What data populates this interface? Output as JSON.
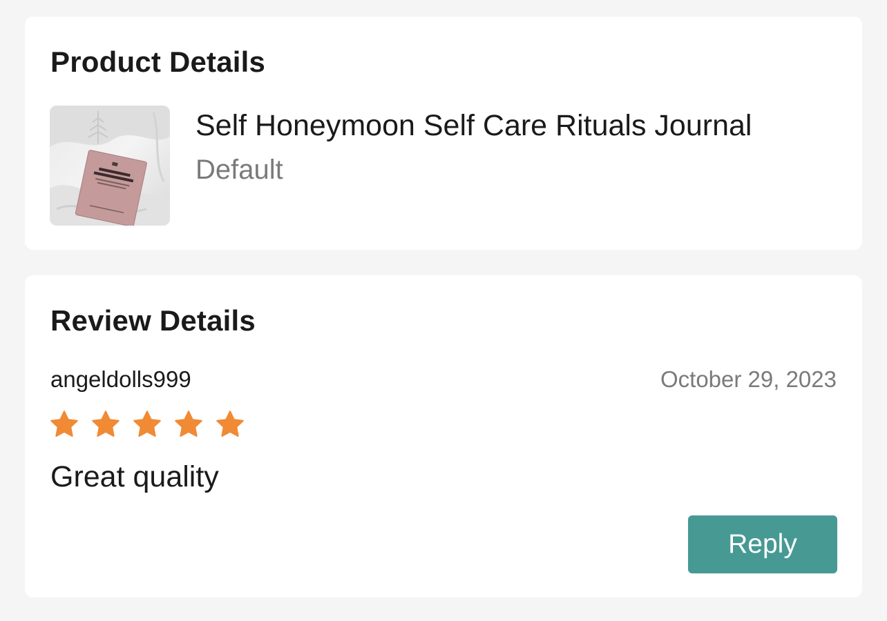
{
  "product_section": {
    "title": "Product Details",
    "product_name": "Self Honeymoon Self Care Rituals Journal",
    "variant": "Default",
    "thumbnail": "product-photo-journal-on-white-bedding"
  },
  "review_section": {
    "title": "Review Details",
    "reviewer": "angeldolls999",
    "date": "October 29, 2023",
    "rating": 5,
    "rating_max": 5,
    "review_text": "Great quality",
    "reply_label": "Reply"
  },
  "colors": {
    "background": "#f5f5f5",
    "card": "#ffffff",
    "star": "#f08a34",
    "reply_button": "#479994",
    "muted_text": "#7a7a7a"
  }
}
